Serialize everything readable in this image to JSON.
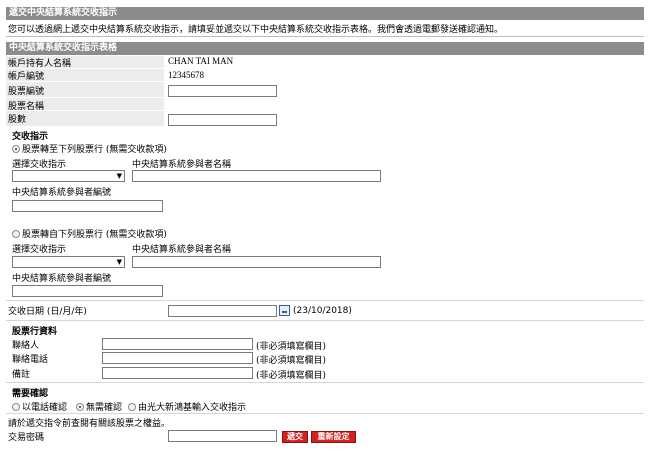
{
  "header": {
    "title": "遞交中央結算系統交收指示",
    "intro": "您可以透過網上遞交中央結算系統交收指示，請填妥並遞交以下中央結算系統交收指示表格。我們會透過電郵發送確認通知。"
  },
  "form": {
    "title": "中央結算系統交收指示表格",
    "account_holder_label": "帳戶持有人名稱",
    "account_holder_value": "CHAN TAI MAN",
    "account_no_label": "帳戶編號",
    "account_no_value": "12345678",
    "stock_code_label": "股票編號",
    "stock_name_label": "股票名稱",
    "quantity_label": "股數"
  },
  "instruction": {
    "title": "交收指示",
    "option1_label": "股票轉至下列股票行 (無需交收款項)",
    "option2_label": "股票轉自下列股票行 (無需交收款項)",
    "select_label": "選擇交收指示",
    "participant_name_label": "中央結算系統參與者名稱",
    "participant_id_label": "中央結算系統參與者編號",
    "settle_date_label": "交收日期 (日/月/年)",
    "settle_date_hint": "(23/10/2018)"
  },
  "broker": {
    "title": "股票行資料",
    "contact_label": "聯絡人",
    "phone_label": "聯絡電話",
    "remark_label": "備註",
    "optional_hint": "(非必須填寫欄目)"
  },
  "confirm": {
    "title": "需要確認",
    "opt_phone": "以電話確認",
    "opt_none": "無需確認",
    "opt_ebroker": "由光大新鴻基輸入交收指示",
    "notice": "請於遞交指令前查閱有關該股票之權益。",
    "password_label": "交易密碼",
    "submit_label": "遞交",
    "reset_label": "重新設定"
  },
  "colors": {
    "header_bg": "#8c8c8c",
    "button_bg": "#d52020"
  }
}
